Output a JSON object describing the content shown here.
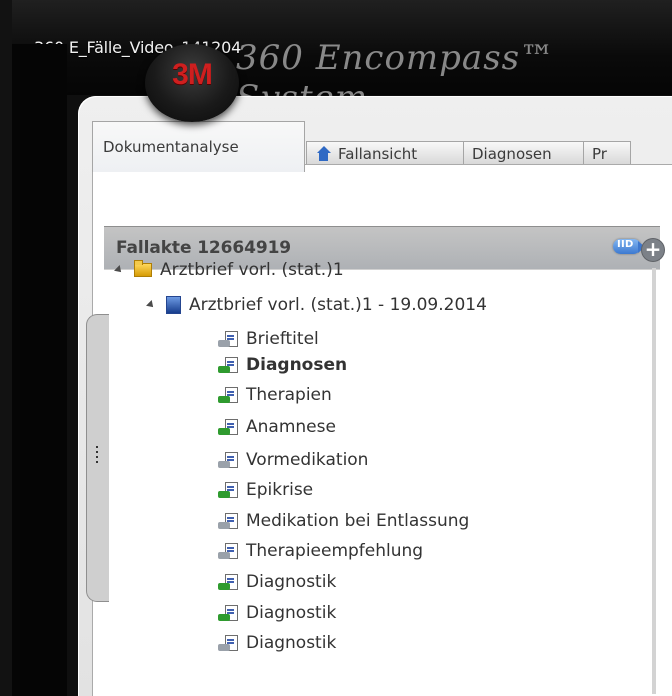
{
  "window": {
    "video_title": "360 E_Fälle_Video_141204",
    "logo_text": "3M",
    "app_title": "360 Encompass™ System"
  },
  "tabs": [
    {
      "label": "Dokumentanalyse",
      "active": true,
      "icon": ""
    },
    {
      "label": "Fallansicht",
      "active": false,
      "icon": "house-icon"
    },
    {
      "label": "Diagnosen",
      "active": false,
      "icon": ""
    },
    {
      "label": "Pr",
      "active": false,
      "icon": ""
    }
  ],
  "case_file": {
    "label": "Fallakte 12664919",
    "button_text": "IID",
    "plus_icon": "plus-circle-icon"
  },
  "tree": {
    "root": {
      "label": "Arztbrief vorl. (stat.)1",
      "icon": "folder-icon"
    },
    "child": {
      "label": "Arztbrief vorl. (stat.)1 - 19.09.2014",
      "icon": "document-icon"
    },
    "items": [
      {
        "label": "Brieftitel",
        "bold": false,
        "status": "#9aa1aa"
      },
      {
        "label": "Diagnosen",
        "bold": true,
        "status": "#2f9b2f"
      },
      {
        "label": "Therapien",
        "bold": false,
        "status": "#2f9b2f"
      },
      {
        "label": "Anamnese",
        "bold": false,
        "status": "#2f9b2f"
      },
      {
        "label": "Vormedikation",
        "bold": false,
        "status": "#9aa1aa"
      },
      {
        "label": "Epikrise",
        "bold": false,
        "status": "#2f9b2f"
      },
      {
        "label": "Medikation bei Entlassung",
        "bold": false,
        "status": "#9aa1aa"
      },
      {
        "label": "Therapieempfehlung",
        "bold": false,
        "status": "#9aa1aa"
      },
      {
        "label": "Diagnostik",
        "bold": false,
        "status": "#2f9b2f"
      },
      {
        "label": "Diagnostik",
        "bold": false,
        "status": "#2f9b2f"
      },
      {
        "label": "Diagnostik",
        "bold": false,
        "status": "#9aa1aa"
      }
    ]
  }
}
